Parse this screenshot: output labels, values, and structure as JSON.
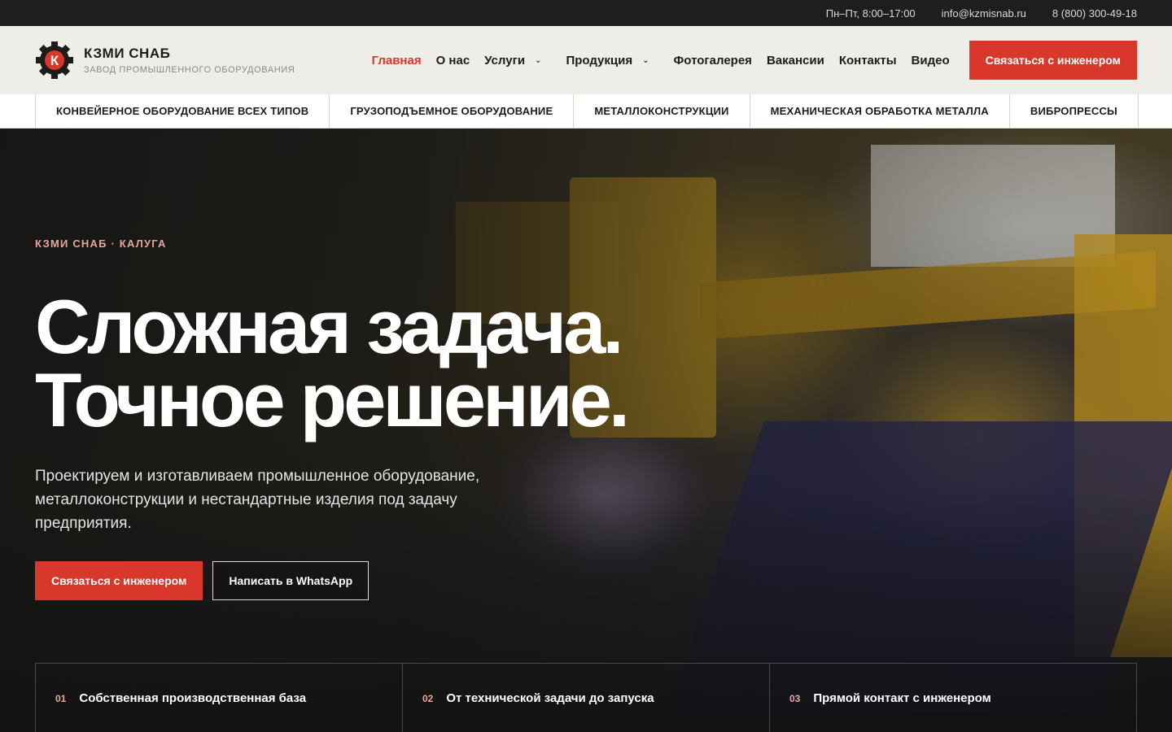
{
  "topbar": {
    "hours": "Пн–Пт, 8:00–17:00",
    "email": "info@kzmisnab.ru",
    "phone": "8 (800) 300-49-18"
  },
  "brand": {
    "logo_letter": "К",
    "title": "КЗМИ СНАБ",
    "subtitle": "ЗАВОД ПРОМЫШЛЕННОГО ОБОРУДОВАНИЯ"
  },
  "nav": {
    "items": [
      {
        "label": "Главная",
        "active": true
      },
      {
        "label": "О нас"
      },
      {
        "label": "Услуги",
        "dropdown": true
      },
      {
        "label": "Продукция",
        "dropdown": true
      },
      {
        "label": "Фотогалерея"
      },
      {
        "label": "Вакансии"
      },
      {
        "label": "Контакты"
      },
      {
        "label": "Видео"
      }
    ],
    "cta": "Связаться с инженером"
  },
  "subnav": [
    "КОНВЕЙЕРНОЕ ОБОРУДОВАНИЕ ВСЕХ ТИПОВ",
    "ГРУЗОПОДЪЕМНОЕ ОБОРУДОВАНИЕ",
    "МЕТАЛЛОКОНСТРУКЦИИ",
    "МЕХАНИЧЕСКАЯ ОБРАБОТКА МЕТАЛЛА",
    "ВИБРОПРЕССЫ"
  ],
  "hero": {
    "eyebrow": "КЗМИ СНАБ · КАЛУГА",
    "headline_line1": "Сложная задача.",
    "headline_line2": "Точное решение.",
    "lead": "Проектируем и изготавливаем промышленное оборудование, металлоконструкции и нестандартные изделия под задачу предприятия.",
    "primary_button": "Связаться с инженером",
    "secondary_button": "Написать в WhatsApp"
  },
  "features": [
    {
      "num": "01",
      "text": "Собственная производственная база"
    },
    {
      "num": "02",
      "text": "От технической задачи до запуска"
    },
    {
      "num": "03",
      "text": "Прямой контакт с инженером"
    }
  ],
  "colors": {
    "accent": "#d9372c",
    "header_bg": "#efede7",
    "topbar_bg": "#1e1e1e"
  }
}
